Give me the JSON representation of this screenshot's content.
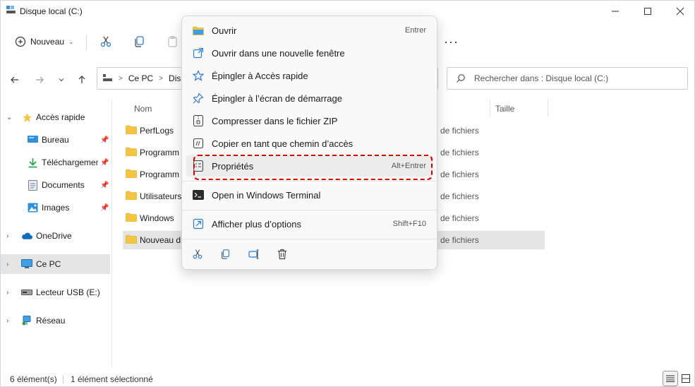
{
  "window": {
    "title": "Disque local (C:)",
    "controls": [
      "minimize-icon",
      "maximize-icon",
      "close-icon"
    ]
  },
  "toolbar": {
    "new_label": "Nouveau",
    "icons": [
      "cut-icon",
      "copy-icon",
      "paste-icon"
    ],
    "more_label": "···"
  },
  "address": {
    "crumbs": [
      "Ce PC",
      "Disq"
    ],
    "separator": ">",
    "search_placeholder": "Rechercher dans : Disque local (C:)"
  },
  "sidebar": {
    "items": [
      {
        "label": "Accès rapide",
        "icon": "star-icon",
        "expanded": true
      },
      {
        "label": "Bureau",
        "icon": "desktop-icon",
        "pinned": true
      },
      {
        "label": "Téléchargements",
        "icon": "download-icon",
        "pinned": true
      },
      {
        "label": "Documents",
        "icon": "document-icon",
        "pinned": true
      },
      {
        "label": "Images",
        "icon": "image-icon",
        "pinned": true
      },
      {
        "label": "OneDrive",
        "icon": "cloud-icon"
      },
      {
        "label": "Ce PC",
        "icon": "monitor-icon",
        "selected": true
      },
      {
        "label": "Lecteur USB (E:)",
        "icon": "usb-drive-icon"
      },
      {
        "label": "Réseau",
        "icon": "network-icon"
      }
    ]
  },
  "file_list": {
    "columns": [
      "Nom",
      "Taille"
    ],
    "rows": [
      {
        "name": "PerfLogs",
        "type": "de fichiers"
      },
      {
        "name": "Programm",
        "type": "de fichiers"
      },
      {
        "name": "Programm",
        "type": "de fichiers"
      },
      {
        "name": "Utilisateurs",
        "type": "de fichiers"
      },
      {
        "name": "Windows",
        "type": "de fichiers"
      },
      {
        "name": "Nouveau d",
        "type": "de fichiers",
        "selected": true
      }
    ]
  },
  "context_menu": {
    "items": [
      {
        "label": "Ouvrir",
        "shortcut": "Entrer",
        "icon": "folder-open-icon"
      },
      {
        "label": "Ouvrir dans une nouvelle fenêtre",
        "shortcut": "",
        "icon": "new-window-icon"
      },
      {
        "label": "Épingler à Accès rapide",
        "shortcut": "",
        "icon": "star-outline-icon"
      },
      {
        "label": "Épingler à l’écran de démarrage",
        "shortcut": "",
        "icon": "pin-icon"
      },
      {
        "label": "Compresser dans le fichier ZIP",
        "shortcut": "",
        "icon": "zip-icon"
      },
      {
        "label": "Copier en tant que chemin d’accès",
        "shortcut": "",
        "icon": "copy-path-icon"
      },
      {
        "label": "Propriétés",
        "shortcut": "Alt+Entrer",
        "icon": "properties-icon",
        "highlighted": true
      },
      {
        "label": "Open in Windows Terminal",
        "shortcut": "",
        "icon": "terminal-icon"
      },
      {
        "label": "Afficher plus d’options",
        "shortcut": "Shift+F10",
        "icon": "more-options-icon"
      }
    ],
    "footer_icons": [
      "cut-icon",
      "copy-icon",
      "rename-icon",
      "delete-icon"
    ]
  },
  "status": {
    "count": "6 élément(s)",
    "selection": "1 élément sélectionné"
  },
  "colors": {
    "folder": "#f5c542",
    "accent": "#0067c0",
    "highlight": "#d30000",
    "selection": "#e5e5e5"
  }
}
